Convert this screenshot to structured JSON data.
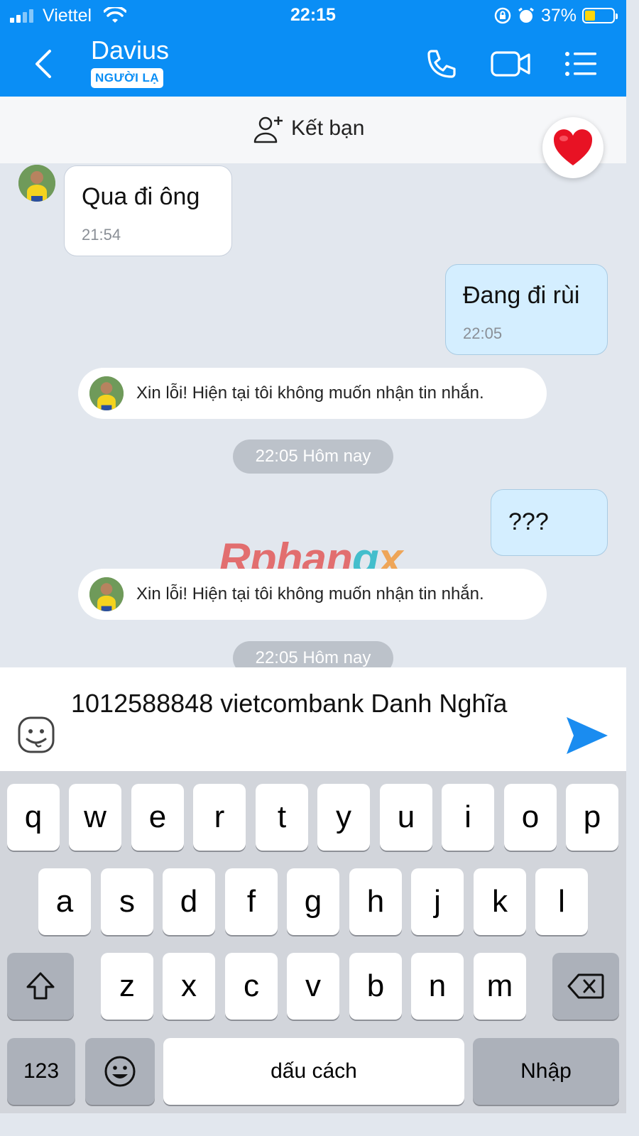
{
  "status_bar": {
    "carrier": "Viettel",
    "time": "22:15",
    "battery": "37%"
  },
  "header": {
    "contact_name": "Davius",
    "badge": "NGƯỜI LẠ"
  },
  "add_friend": {
    "label": "Kết bạn"
  },
  "messages": {
    "m1": {
      "text": "Qua đi ông",
      "time": "21:54"
    },
    "m2": {
      "text": "Đang đi rùi",
      "time": "22:05"
    },
    "sys1": "Xin lỗi! Hiện tại tôi không muốn nhận tin nhắn.",
    "date1": "22:05 Hôm nay",
    "m3": {
      "text": "???"
    },
    "sys2": "Xin lỗi! Hiện tại tôi không muốn nhận tin nhắn.",
    "date2": "22:05 Hôm nay"
  },
  "watermark": {
    "part1": "Rphan",
    "part2": "g",
    "part3": "x"
  },
  "composer": {
    "text": "1012588848 vietcombank Danh Nghĩa"
  },
  "keyboard": {
    "row1": [
      "q",
      "w",
      "e",
      "r",
      "t",
      "y",
      "u",
      "i",
      "o",
      "p"
    ],
    "row2": [
      "a",
      "s",
      "d",
      "f",
      "g",
      "h",
      "j",
      "k",
      "l"
    ],
    "row3": [
      "z",
      "x",
      "c",
      "v",
      "b",
      "n",
      "m"
    ],
    "num_key": "123",
    "space_key": "dấu cách",
    "return_key": "Nhập"
  },
  "colors": {
    "header_blue": "#0a8ef5",
    "outgoing_bubble": "#d4eeff",
    "send_blue": "#1a8cf0"
  }
}
